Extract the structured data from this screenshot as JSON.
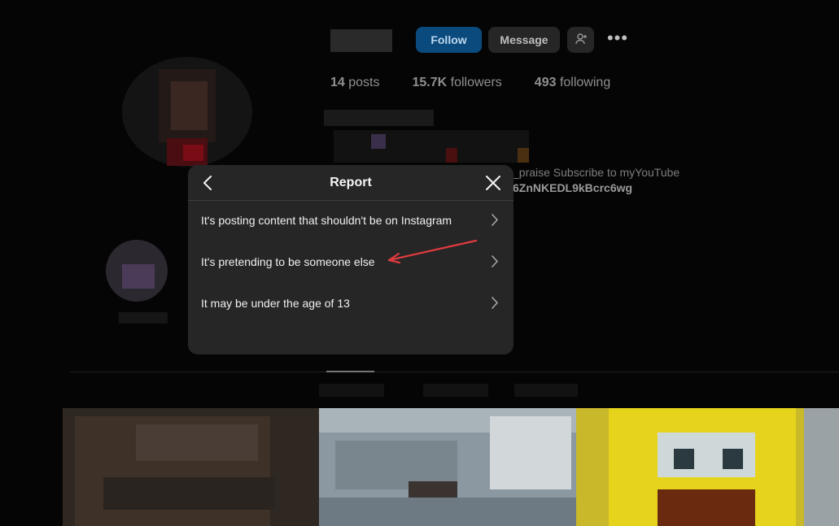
{
  "profile": {
    "follow_label": "Follow",
    "message_label": "Message",
    "more_label": "•••",
    "stats": {
      "posts_count": "14",
      "posts_label": "posts",
      "followers_count": "15.7K",
      "followers_label": "followers",
      "following_count": "493",
      "following_label": "following"
    },
    "bio_fragment": "_praise Subscribe to myYouTube",
    "bio_link_fragment": "6ZnNKEDL9kBcrc6wg"
  },
  "report_dialog": {
    "title": "Report",
    "back_icon": "chevron-left-icon",
    "close_icon": "close-icon",
    "options": [
      {
        "label": "It's posting content that shouldn't be on Instagram",
        "icon": "chevron-right-icon"
      },
      {
        "label": "It's pretending to be someone else",
        "icon": "chevron-right-icon"
      },
      {
        "label": "It may be under the age of 13",
        "icon": "chevron-right-icon"
      }
    ]
  },
  "colors": {
    "modal_bg": "#262626",
    "follow_button": "#0a4a7d",
    "annotation_arrow": "#e03a3e"
  }
}
